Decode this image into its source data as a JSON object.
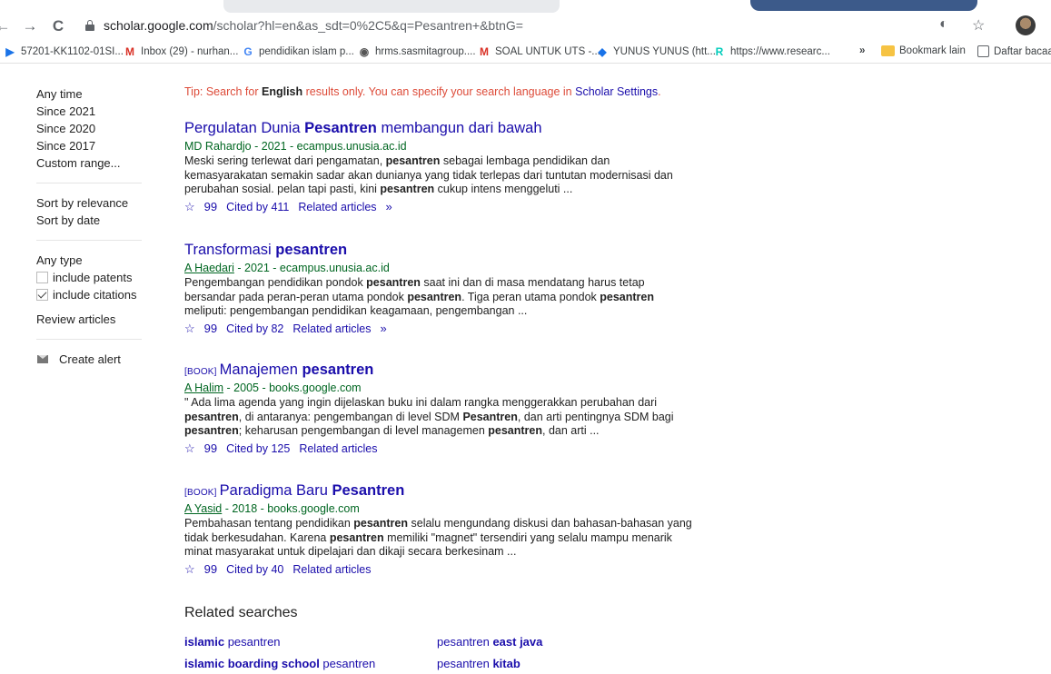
{
  "browser": {
    "url_host": "scholar.google.com",
    "url_path": "/scholar?hl=en&as_sdt=0%2C5&q=Pesantren+&btnG=",
    "back_glyph": "←",
    "forward_glyph": "→",
    "reload_glyph": "C",
    "star_glyph": "☆",
    "ext_glyph": "◐"
  },
  "bookmarks": [
    {
      "label": "57201-KK1102-01SI...",
      "icon": "document-icon",
      "glyph": "▶",
      "color": "#1a73e8"
    },
    {
      "label": "Inbox (29) - nurhan...",
      "icon": "gmail-icon",
      "glyph": "M",
      "color": "#d93025"
    },
    {
      "label": "pendidikan islam p...",
      "icon": "google-icon",
      "glyph": "G",
      "color": "#4285f4"
    },
    {
      "label": "hrms.sasmitagroup....",
      "icon": "globe-icon",
      "glyph": "◉",
      "color": "#555555"
    },
    {
      "label": "SOAL UNTUK UTS -...",
      "icon": "gmail-icon",
      "glyph": "M",
      "color": "#d93025"
    },
    {
      "label": "YUNUS YUNUS (htt...",
      "icon": "diamond-icon",
      "glyph": "◆",
      "color": "#1a73e8"
    },
    {
      "label": "https://www.researc...",
      "icon": "researchgate-icon",
      "glyph": "R",
      "color": "#00ccbb"
    }
  ],
  "bookmarks_more": "»",
  "bookmarks_folder": "Bookmark lain",
  "reading_list": "Daftar bacaa",
  "sidebar": {
    "time_header": "Any time",
    "time_items": [
      "Since 2021",
      "Since 2020",
      "Since 2017",
      "Custom range..."
    ],
    "sort_header": "Sort by relevance",
    "sort_items": [
      "Sort by date"
    ],
    "type_header": "Any type",
    "include_patents": "include patents",
    "include_citations": "include citations",
    "review_articles": "Review articles",
    "create_alert": "Create alert"
  },
  "tip": {
    "prefix": "Tip: Search for ",
    "bold": "English",
    "middle": " results only. You can specify your search language in ",
    "link": "Scholar Settings",
    "suffix": "."
  },
  "results": [
    {
      "tag": "",
      "title_pre": "Pergulatan Dunia ",
      "title_bold": "Pesantren",
      "title_post": " membangun dari bawah",
      "author_link": "",
      "author_rest": "MD Rahardjo - 2021 - ecampus.unusia.ac.id",
      "snippet_html": "Meski sering terlewat dari pengamatan, <b>pesantren</b> sebagai lembaga pendidikan dan kemasyarakatan semakin sadar akan dunianya yang tidak terlepas dari tuntutan modernisasi dan perubahan sosial. pelan tapi pasti, kini <b>pesantren</b> cukup intens menggeluti ...",
      "cited": "Cited by 411",
      "related": "Related articles",
      "versions": true
    },
    {
      "tag": "",
      "title_pre": "Transformasi ",
      "title_bold": "pesantren",
      "title_post": "",
      "author_link": "A Haedari",
      "author_rest": " - 2021 - ecampus.unusia.ac.id",
      "snippet_html": "Pengembangan pendidikan pondok <b>pesantren</b> saat ini dan di masa mendatang harus tetap bersandar pada peran-peran utama pondok <b>pesantren</b>. Tiga peran utama pondok <b>pesantren</b> meliputi: pengembangan pendidikan keagamaan, pengembangan ...",
      "cited": "Cited by 82",
      "related": "Related articles",
      "versions": true
    },
    {
      "tag": "[BOOK]",
      "title_pre": "Manajemen ",
      "title_bold": "pesantren",
      "title_post": "",
      "author_link": "A Halim",
      "author_rest": " - 2005 - books.google.com",
      "snippet_html": "\" Ada lima agenda yang ingin dijelaskan buku ini dalam rangka menggerakkan perubahan dari <b>pesantren</b>, di antaranya: pengembangan di level SDM <b>Pesantren</b>, dan arti pentingnya SDM bagi <b>pesantren</b>; keharusan pengembangan di level managemen <b>pesantren</b>, dan arti ...",
      "cited": "Cited by 125",
      "related": "Related articles",
      "versions": false
    },
    {
      "tag": "[BOOK]",
      "title_pre": "Paradigma Baru ",
      "title_bold": "Pesantren",
      "title_post": "",
      "author_link": "A Yasid",
      "author_rest": " - 2018 - books.google.com",
      "snippet_html": "Pembahasan tentang pendidikan <b>pesantren</b> selalu mengundang diskusi dan bahasan-bahasan yang tidak berkesudahan. Karena <b>pesantren</b> memiliki \"magnet\" tersendiri yang selalu mampu menarik minat masyarakat untuk dipelajari dan dikaji secara berkesinam ...",
      "cited": "Cited by 40",
      "related": "Related articles",
      "versions": false
    }
  ],
  "related_searches": {
    "title": "Related searches",
    "items": [
      {
        "bold": "islamic",
        "rest": " pesantren"
      },
      {
        "bold": "islamic boarding school",
        "rest": " pesantren"
      },
      {
        "pre": "pesantren ",
        "bold": "east java"
      },
      {
        "pre": "pesantren ",
        "bold": "kitab"
      }
    ]
  }
}
